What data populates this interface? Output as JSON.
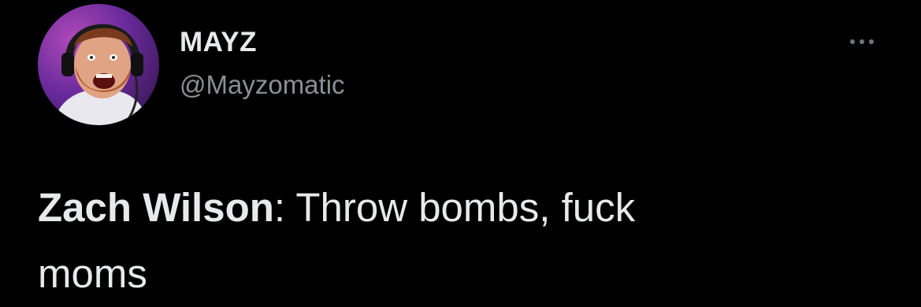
{
  "tweet": {
    "author": {
      "display_name": "MAYZ",
      "handle": "@Mayzomatic",
      "avatar_icon": "profile-photo"
    },
    "more_icon": "more-dots-icon",
    "text": {
      "speaker": "Zach Wilson",
      "separator": ":",
      "line1": " Throw bombs, fuck",
      "line2": "moms"
    }
  },
  "colors": {
    "background": "#000000",
    "primary_text": "#e7e9ea",
    "secondary_text": "#8b8f94"
  }
}
